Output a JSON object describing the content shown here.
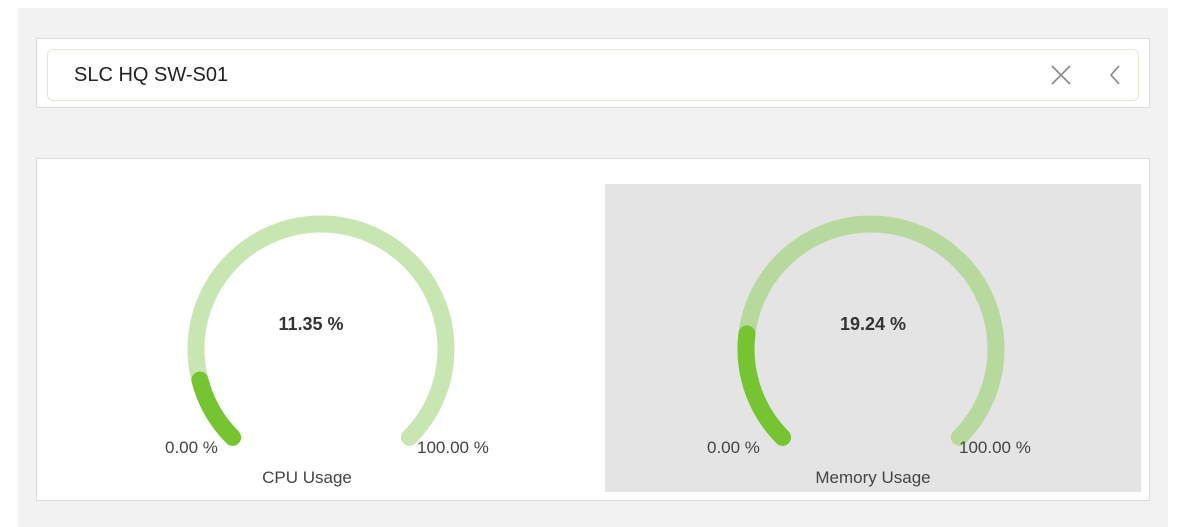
{
  "header": {
    "device_name": "SLC HQ SW-S01",
    "close_icon": "close-icon",
    "back_icon": "chevron-left-icon"
  },
  "gauges": [
    {
      "id": "cpu",
      "value_label": "11.35 %",
      "value": 11.35,
      "min_label": "0.00 %",
      "max_label": "100.00 %",
      "min": 0,
      "max": 100,
      "label": "CPU Usage",
      "track_color": "#c8e6b2",
      "fill_color": "#76c431"
    },
    {
      "id": "memory",
      "value_label": "19.24 %",
      "value": 19.24,
      "min_label": "0.00 %",
      "max_label": "100.00 %",
      "min": 0,
      "max": 100,
      "label": "Memory Usage",
      "track_color": "#b8d99e",
      "fill_color": "#76c431"
    }
  ]
}
